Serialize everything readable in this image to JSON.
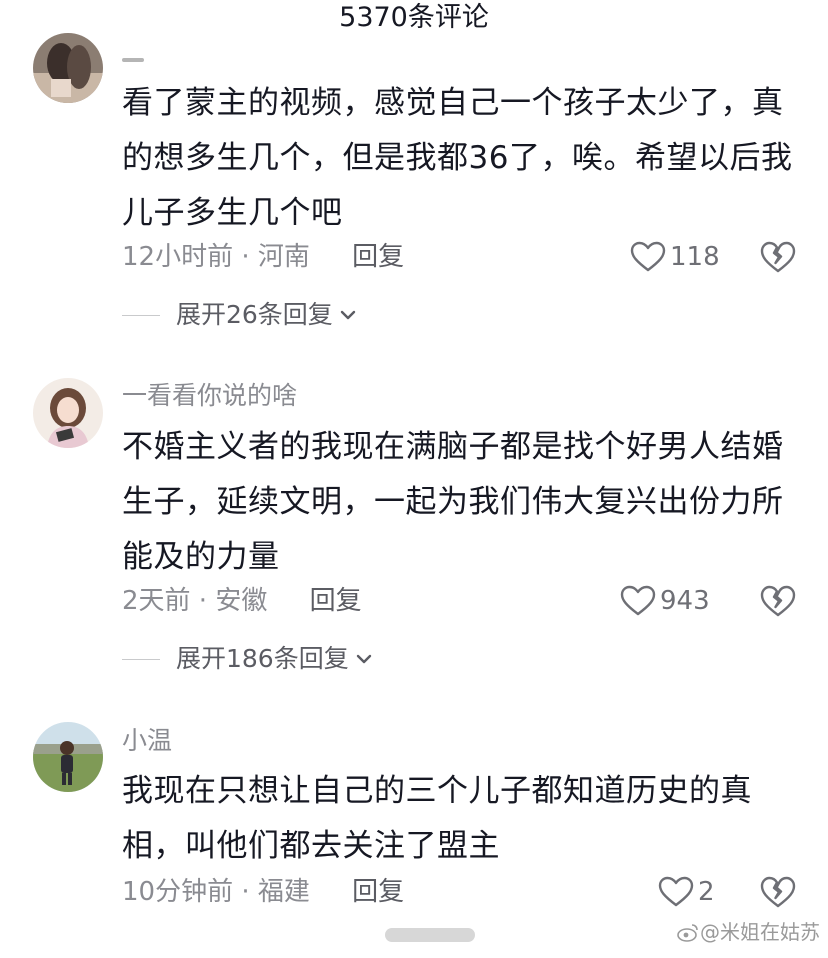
{
  "header": {
    "title": "5370条评论"
  },
  "comments": [
    {
      "username": "",
      "text": "看了蒙主的视频，感觉自己一个孩子太少了，真的想多生几个，但是我都36了，唉。希望以后我儿子多生几个吧",
      "time_location": "12小时前 · 河南",
      "reply_label": "回复",
      "likes": "118",
      "expand_label": "展开26条回复"
    },
    {
      "username": "一看看你说的啥",
      "text": "不婚主义者的我现在满脑子都是找个好男人结婚生子，延续文明，一起为我们伟大复兴出份力所能及的力量",
      "time_location": "2天前 · 安徽",
      "reply_label": "回复",
      "likes": "943",
      "expand_label": "展开186条回复"
    },
    {
      "username": "小温",
      "text": "我现在只想让自己的三个儿子都知道历史的真相，叫他们都去关注了盟主",
      "time_location": "10分钟前 · 福建",
      "reply_label": "回复",
      "likes": "2"
    }
  ],
  "watermark": {
    "text": "@米姐在姑苏"
  },
  "icons": [
    "heart-icon",
    "broken-heart-icon",
    "chevron-down-icon",
    "weibo-icon"
  ],
  "colors": {
    "text": "#161823",
    "meta": "#8a8b91",
    "icon": "#6e6f75"
  }
}
